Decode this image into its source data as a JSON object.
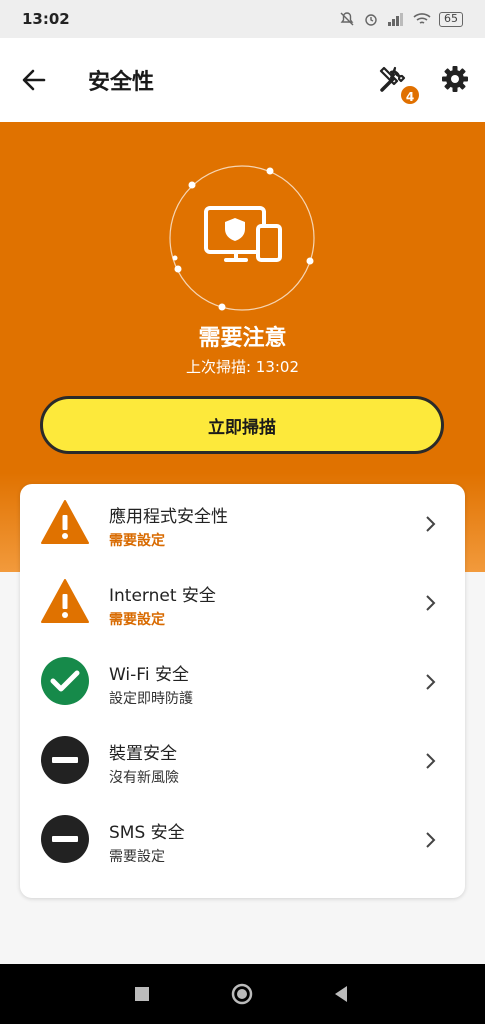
{
  "status_bar": {
    "time": "13:02",
    "battery": "65"
  },
  "app_bar": {
    "title": "安全性",
    "tools_badge": "4"
  },
  "hero": {
    "status_title": "需要注意",
    "last_scan": "上次掃描: 13:02",
    "scan_button": "立即掃描",
    "accent_color": "#e07200"
  },
  "items": [
    {
      "label": "應用程式安全性",
      "sub": "需要設定",
      "state": "warning"
    },
    {
      "label": "Internet 安全",
      "sub": "需要設定",
      "state": "warning"
    },
    {
      "label": "Wi-Fi 安全",
      "sub": "設定即時防護",
      "state": "ok"
    },
    {
      "label": "裝置安全",
      "sub": "沒有新風險",
      "state": "neutral"
    },
    {
      "label": "SMS 安全",
      "sub": "需要設定",
      "state": "neutral"
    }
  ]
}
